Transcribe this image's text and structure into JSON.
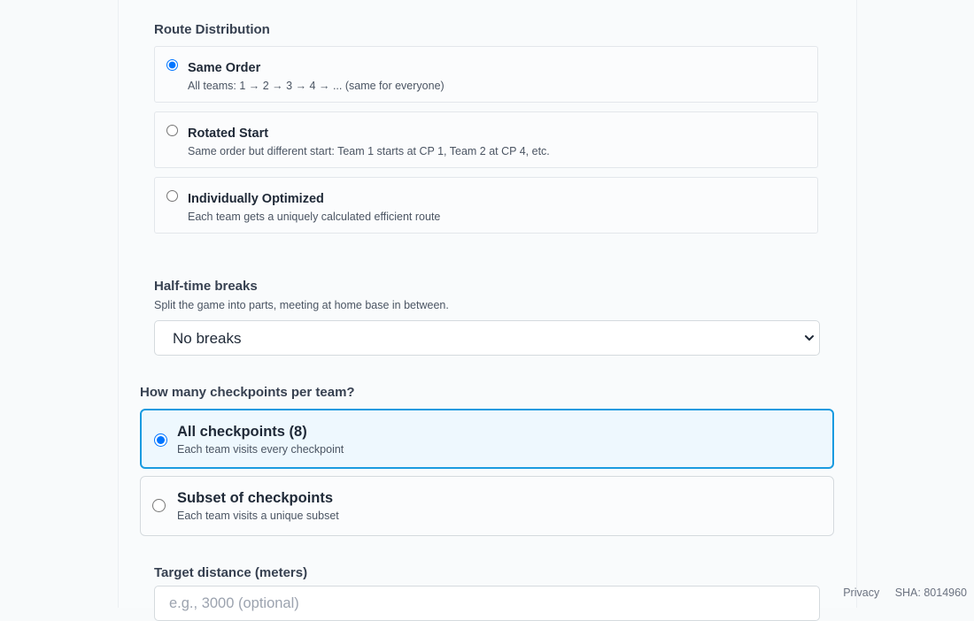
{
  "route_distribution": {
    "label": "Route Distribution",
    "options": [
      {
        "title": "Same Order",
        "desc": "All teams: 1 → 2 → 3 → 4 → ... (same for everyone)",
        "selected": true
      },
      {
        "title": "Rotated Start",
        "desc": "Same order but different start: Team 1 starts at CP 1, Team 2 at CP 4, etc.",
        "selected": false
      },
      {
        "title": "Individually Optimized",
        "desc": "Each team gets a uniquely calculated efficient route",
        "selected": false
      }
    ]
  },
  "halftime": {
    "label": "Half-time breaks",
    "desc": "Split the game into parts, meeting at home base in between.",
    "selected_value": "No breaks"
  },
  "checkpoints": {
    "label": "How many checkpoints per team?",
    "options": [
      {
        "title": "All checkpoints (8)",
        "desc": "Each team visits every checkpoint",
        "selected": true
      },
      {
        "title": "Subset of checkpoints",
        "desc": "Each team visits a unique subset",
        "selected": false
      }
    ]
  },
  "target_distance": {
    "label": "Target distance (meters)",
    "placeholder": "e.g., 3000 (optional)"
  },
  "footer": {
    "privacy": "Privacy",
    "sha": "SHA: 8014960"
  },
  "colors": {
    "accent": "#1a9be0",
    "selected_bg": "#eef8fe"
  }
}
